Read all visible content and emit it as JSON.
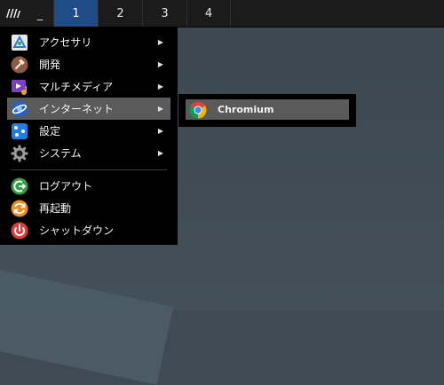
{
  "panel": {
    "logo_text": "ꟿ",
    "minimize_label": "_",
    "workspaces": [
      "1",
      "2",
      "3",
      "4"
    ],
    "active_workspace": "1",
    "colors": {
      "panel_bg": "#1b1b1b",
      "active_ws": "#1f4c86"
    }
  },
  "menu": {
    "items": [
      {
        "label": "アクセサリ",
        "icon": "accessories-icon",
        "has_submenu": true
      },
      {
        "label": "開発",
        "icon": "development-hammer-icon",
        "has_submenu": true
      },
      {
        "label": "マルチメディア",
        "icon": "multimedia-icon",
        "has_submenu": true
      },
      {
        "label": "インターネット",
        "icon": "internet-globe-icon",
        "has_submenu": true,
        "selected": true
      },
      {
        "label": "設定",
        "icon": "settings-icon",
        "has_submenu": true
      },
      {
        "label": "システム",
        "icon": "system-gear-icon",
        "has_submenu": true
      }
    ],
    "actions": [
      {
        "label": "ログアウト",
        "icon": "logout-icon"
      },
      {
        "label": "再起動",
        "icon": "restart-icon"
      },
      {
        "label": "シャットダウン",
        "icon": "shutdown-icon"
      }
    ],
    "submenu_arrow": "▶"
  },
  "submenu": {
    "items": [
      {
        "label": "Chromium",
        "icon": "chromium-icon",
        "selected": true
      }
    ]
  }
}
